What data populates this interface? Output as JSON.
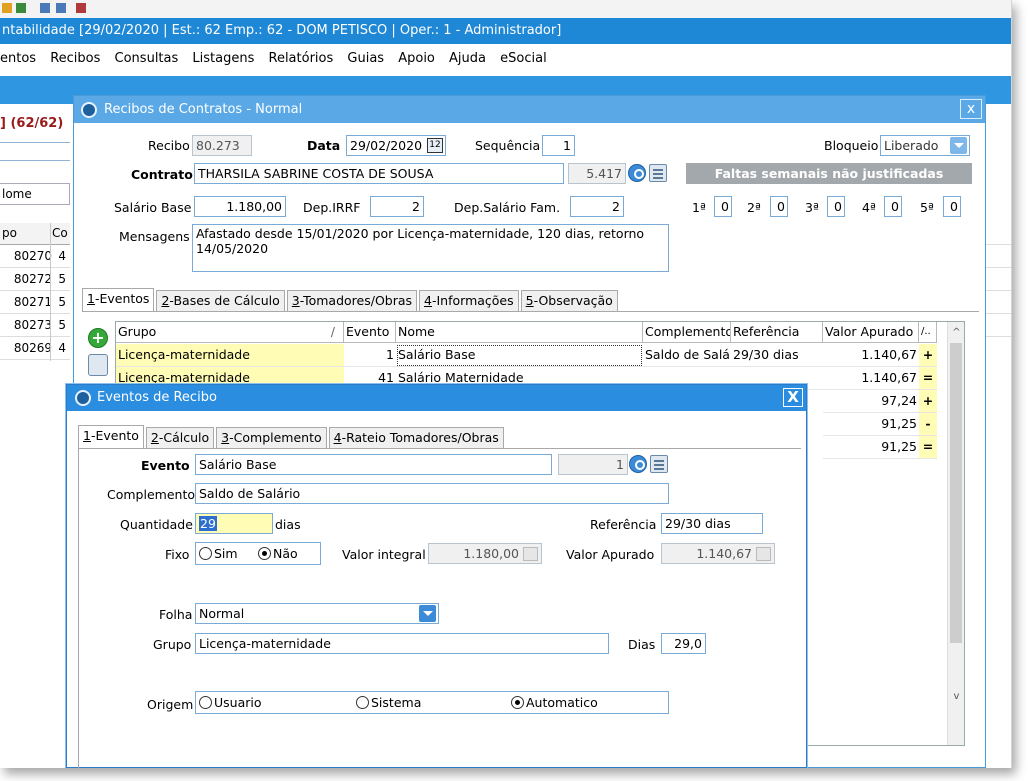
{
  "app": {
    "title": "ntabilidade [29/02/2020 | Est.: 62 Emp.: 62 - DOM PETISCO | Oper.: 1 - Administrador]",
    "menu": [
      "entos",
      "Recibos",
      "Consultas",
      "Listagens",
      "Relatórios",
      "Guias",
      "Apoio",
      "Ajuda",
      "eSocial"
    ],
    "left_title": "] (62/62)",
    "left_nome": "lome",
    "left_headers": [
      "po",
      "Co"
    ],
    "left_rows": [
      {
        "num": "80270",
        "flag": "4"
      },
      {
        "num": "80272",
        "flag": "5"
      },
      {
        "num": "80271",
        "flag": "5"
      },
      {
        "num": "80273",
        "flag": "5"
      },
      {
        "num": "80269",
        "flag": "4"
      }
    ]
  },
  "recibos": {
    "title": "Recibos de Contratos - Normal",
    "close": "x",
    "recibo_label": "Recibo",
    "recibo_value": "80.273",
    "data_label": "Data",
    "data_value": "29/02/2020",
    "data_icon": "12",
    "sequencia_label": "Sequência",
    "sequencia_value": "1",
    "bloqueio_label": "Bloqueio",
    "bloqueio_value": "Liberado",
    "contrato_label": "Contrato",
    "contrato_value": "THARSILA SABRINE COSTA DE SOUSA",
    "contrato_code": "5.417",
    "faltas_header": "Faltas semanais não justificadas",
    "salario_label": "Salário Base",
    "salario_value": "1.180,00",
    "dep_irrf_label": "Dep.IRRF",
    "dep_irrf_value": "2",
    "dep_sal_label": "Dep.Salário Fam.",
    "dep_sal_value": "2",
    "faltas": [
      {
        "label": "1ª",
        "value": "0"
      },
      {
        "label": "2ª",
        "value": "0"
      },
      {
        "label": "3ª",
        "value": "0"
      },
      {
        "label": "4ª",
        "value": "0"
      },
      {
        "label": "5ª",
        "value": "0"
      }
    ],
    "mensagens_label": "Mensagens",
    "mensagens_line1": "Afastado desde 15/01/2020 por Licença-maternidade, 120 dias, retorno",
    "mensagens_line2": "14/05/2020",
    "tabs": [
      {
        "key": "1",
        "label": "-Eventos"
      },
      {
        "key": "2",
        "label": "-Bases de Cálculo"
      },
      {
        "key": "3",
        "label": "-Tomadores/Obras"
      },
      {
        "key": "4",
        "label": "-Informações"
      },
      {
        "key": "5",
        "label": "-Observação"
      }
    ],
    "grid_headers": {
      "grupo": "Grupo",
      "sort": "/",
      "evento": "Evento",
      "nome": "Nome",
      "complemento": "Complemento",
      "referencia": "Referência",
      "valor": "Valor Apurado",
      "flag": "/.."
    },
    "grid_rows": [
      {
        "grupo": "Licença-maternidade",
        "evento": "1",
        "nome": "Salário Base",
        "complemento": "Saldo de Salá",
        "referencia": "29/30 dias",
        "valor": "1.140,67",
        "flag": "+"
      },
      {
        "grupo": "Licença-maternidade",
        "evento": "41",
        "nome": "Salário Maternidade",
        "complemento": "",
        "referencia": "",
        "valor": "1.140,67",
        "flag": "="
      },
      {
        "valor": "97,24",
        "flag": "+"
      },
      {
        "valor": "91,25",
        "flag": "-"
      },
      {
        "valor": "91,25",
        "flag": "="
      }
    ],
    "scroll_up": "^",
    "scroll_down": "v"
  },
  "eventos": {
    "title": "Eventos de Recibo",
    "close": "X",
    "tabs": [
      {
        "key": "1",
        "label": "-Evento"
      },
      {
        "key": "2",
        "label": "-Cálculo"
      },
      {
        "key": "3",
        "label": "-Complemento"
      },
      {
        "key": "4",
        "label": "-Rateio Tomadores/Obras"
      }
    ],
    "evento_label": "Evento",
    "evento_value": "Salário Base",
    "evento_code": "1",
    "complemento_label": "Complemento",
    "complemento_value": "Saldo de Salário",
    "quantidade_label": "Quantidade",
    "quantidade_value": "29",
    "quantidade_unit": "dias",
    "referencia_label": "Referência",
    "referencia_value": "29/30 dias",
    "fixo_label": "Fixo",
    "fixo_sim": "Sim",
    "fixo_nao": "Não",
    "fixo_selected": "nao",
    "valor_integral_label": "Valor integral",
    "valor_integral_value": "1.180,00",
    "valor_apurado_label": "Valor Apurado",
    "valor_apurado_value": "1.140,67",
    "folha_label": "Folha",
    "folha_value": "Normal",
    "grupo_label": "Grupo",
    "grupo_value": "Licença-maternidade",
    "dias_label": "Dias",
    "dias_value": "29,0",
    "origem_label": "Origem",
    "origem_options": [
      "Usuario",
      "Sistema",
      "Automatico"
    ],
    "origem_selected": "Automatico"
  },
  "colors": {
    "titlebar": "#1e88d7",
    "window_title": "#5aa9e6",
    "dialog_title": "#2b8de0",
    "row_highlight": "#fffcb6",
    "faltas_header_bg": "#a3a8ad"
  }
}
